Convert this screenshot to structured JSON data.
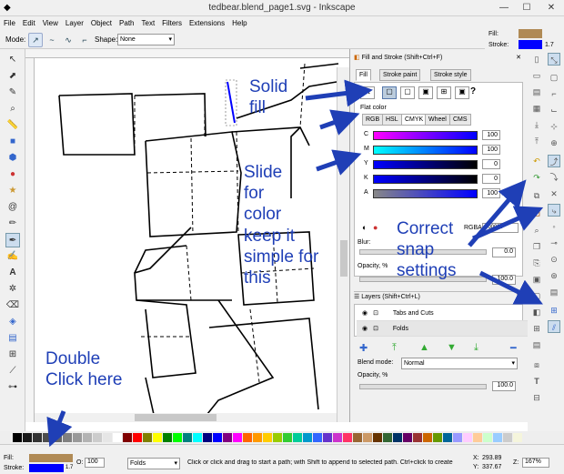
{
  "window": {
    "title": "tedbear.blend_page1.svg - Inkscape",
    "min": "—",
    "max": "☐",
    "close": "✕"
  },
  "menu": [
    "File",
    "Edit",
    "View",
    "Layer",
    "Object",
    "Path",
    "Text",
    "Filters",
    "Extensions",
    "Help"
  ],
  "toolbar": {
    "mode_label": "Mode:",
    "shape_label": "Shape:",
    "shape_value": "None"
  },
  "style_indicator": {
    "fill_label": "Fill:",
    "stroke_label": "Stroke:",
    "stroke_width": "1.7",
    "fill_color": "#b08a55",
    "stroke_color": "#0000ff"
  },
  "fill_stroke": {
    "title": "Fill and Stroke (Shift+Ctrl+F)",
    "tabs": [
      "Fill",
      "Stroke paint",
      "Stroke style"
    ],
    "flat_color_label": "Flat color",
    "color_tabs": [
      "RGB",
      "HSL",
      "CMYK",
      "Wheel",
      "CMS"
    ],
    "sliders": [
      {
        "letter": "C",
        "value": "100"
      },
      {
        "letter": "M",
        "value": "100"
      },
      {
        "letter": "Y",
        "value": "0"
      },
      {
        "letter": "K",
        "value": "0"
      },
      {
        "letter": "A",
        "value": "100"
      }
    ],
    "rgba_label": "RGBA:",
    "rgba_value": "0000ffff",
    "blur_label": "Blur:",
    "blur_value": "0.0",
    "opacity_label": "Opacity, %",
    "opacity_value": "100.0"
  },
  "layers": {
    "title": "Layers (Shift+Ctrl+L)",
    "rows": [
      "Tabs and Cuts",
      "Folds"
    ],
    "blend_label": "Blend mode:",
    "blend_value": "Normal",
    "opacity_label": "Opacity, %",
    "opacity_value": "100.0"
  },
  "status": {
    "fill_label": "Fill:",
    "stroke_label": "Stroke:",
    "stroke_width": "1.7",
    "o_label": "O:",
    "o_value": "100",
    "layer": "Folds",
    "message": "Click or click and drag to start a path; with Shift to append to selected path. Ctrl+click to create",
    "x_label": "X:",
    "x_value": "293.89",
    "y_label": "Y:",
    "y_value": "337.67",
    "z_label": "Z:",
    "z_value": "167%"
  },
  "annotations": {
    "solid_fill": "Solid\nfill",
    "slide": "Slide\nfor\ncolor\nkeep it\nsimple for\nthis",
    "snap": "Correct\nsnap\nsettings",
    "double_click": "Double\nClick here"
  },
  "colors": {
    "annotation": "#1f3fb6",
    "arrow": "#1f3fb6"
  }
}
